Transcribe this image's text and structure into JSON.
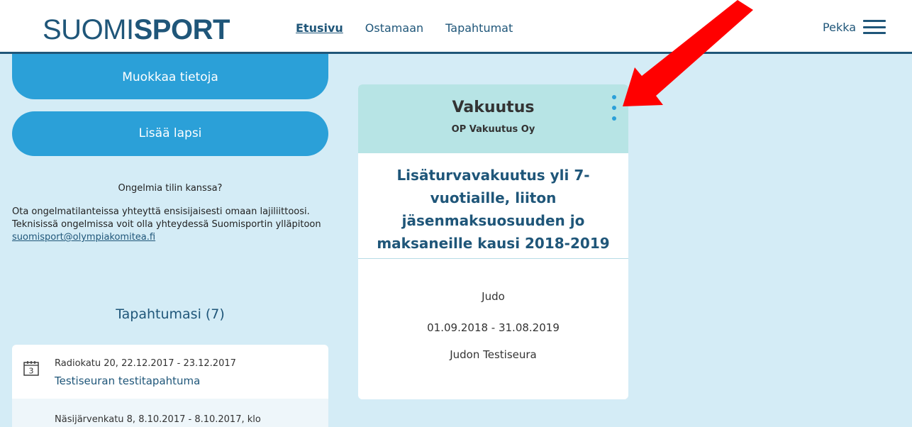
{
  "header": {
    "logo_light": "SUOMI",
    "logo_bold": "SPORT",
    "nav": [
      {
        "label": "Etusivu",
        "active": true
      },
      {
        "label": "Ostamaan",
        "active": false
      },
      {
        "label": "Tapahtumat",
        "active": false
      }
    ],
    "user_name": "Pekka"
  },
  "sidebar": {
    "edit_button": "Muokkaa tietoja",
    "add_child_button": "Lisää lapsi",
    "help_title": "Ongelmia tilin kanssa?",
    "help_text": "Ota ongelmatilanteissa yhteyttä ensisijaisesti omaan lajiliittoosi. Teknisissä ongelmissa voit olla yhteydessä Suomisportin ylläpitoon",
    "help_email": "suomisport@olympiakomitea.fi",
    "events_title": "Tapahtumasi (7)",
    "events": [
      {
        "meta": "Radiokatu 20, 22.12.2017 - 23.12.2017",
        "name": "Testiseuran testitapahtuma",
        "calendar_day": "3"
      },
      {
        "meta": "Näsijärvenkatu 8, 8.10.2017 - 8.10.2017, klo"
      }
    ]
  },
  "card": {
    "title": "Vakuutus",
    "subtitle": "OP Vakuutus Oy",
    "product_title": "Lisäturvavakuutus yli 7-vuotiaille, liiton jäsenmaksuosuuden jo maksaneille kausi 2018-2019",
    "sport": "Judo",
    "dates": "01.09.2018 - 31.08.2019",
    "club": "Judon Testiseura"
  },
  "colors": {
    "brand_dark": "#1f5679",
    "button_blue": "#2ba0d8",
    "background": "#d4ecf6",
    "card_header": "#b7e4e5",
    "annotation_arrow": "#ff0000"
  }
}
